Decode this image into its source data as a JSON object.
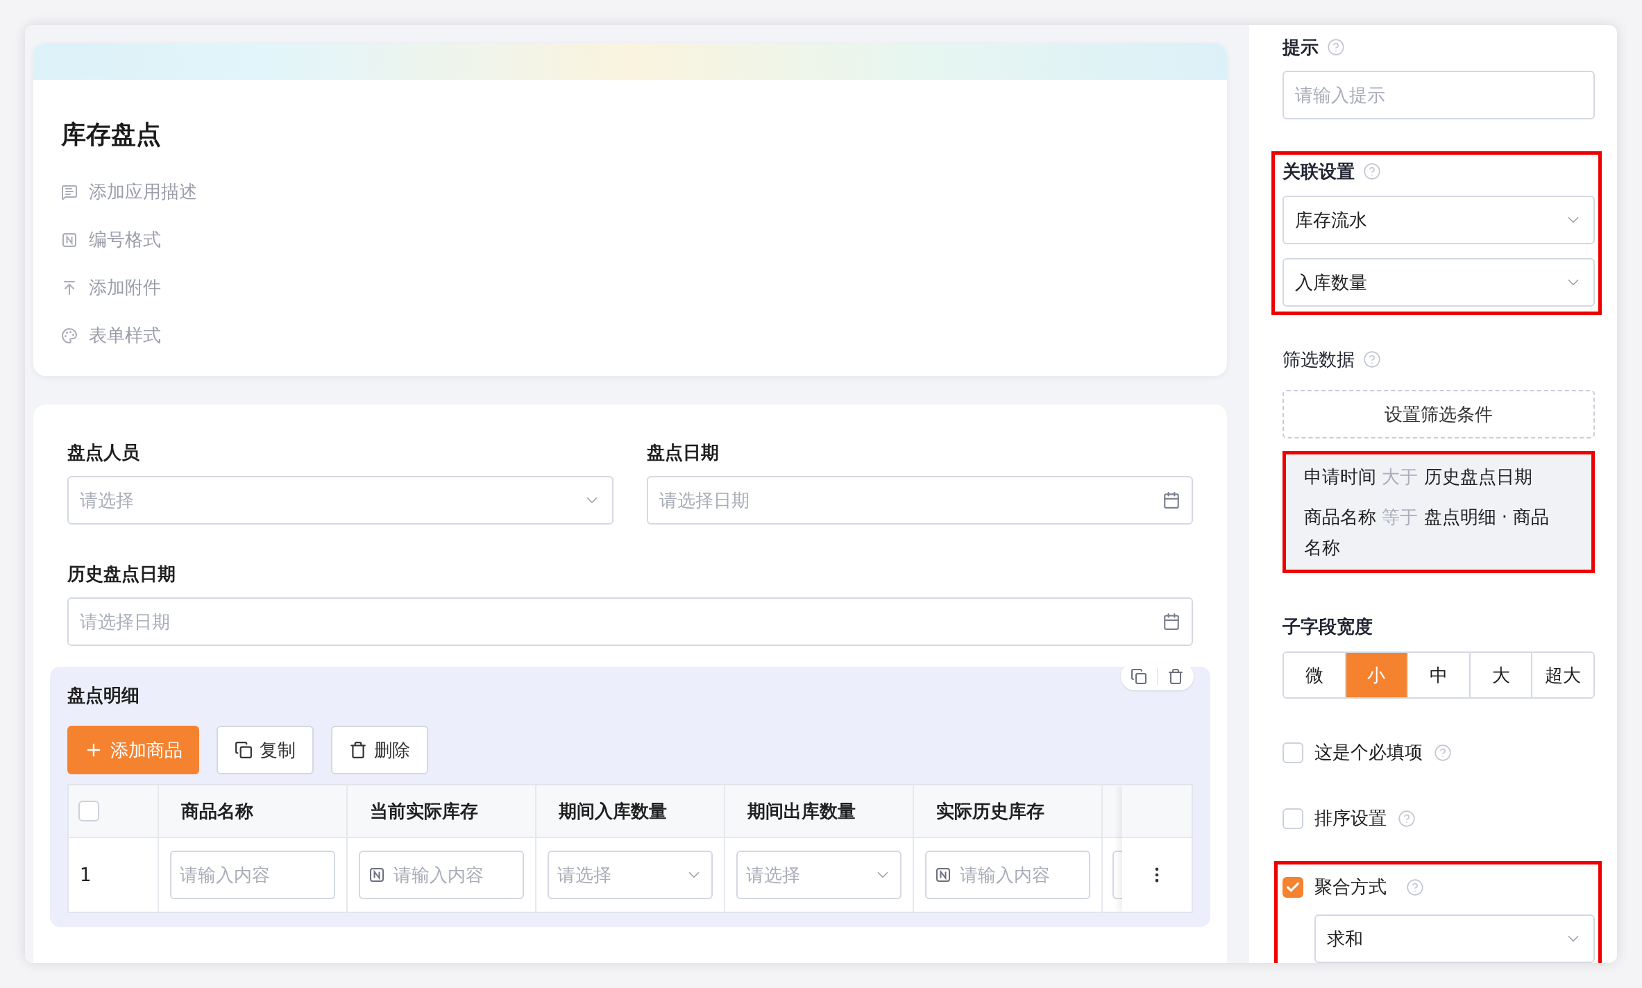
{
  "app": {
    "title": "库存盘点",
    "actions": [
      {
        "kind": "description",
        "label": "添加应用描述"
      },
      {
        "kind": "numbering",
        "label": "编号格式"
      },
      {
        "kind": "attachment",
        "label": "添加附件"
      },
      {
        "kind": "style",
        "label": "表单样式"
      }
    ]
  },
  "form": {
    "fields": [
      {
        "label": "盘点人员",
        "kind": "select",
        "placeholder": "请选择"
      },
      {
        "label": "盘点日期",
        "kind": "date",
        "placeholder": "请选择日期"
      },
      {
        "label": "历史盘点日期",
        "kind": "date",
        "placeholder": "请选择日期"
      }
    ]
  },
  "subtable": {
    "title": "盘点明细",
    "buttons": [
      {
        "kind": "add",
        "label": "添加商品"
      },
      {
        "kind": "copy",
        "label": "复制"
      },
      {
        "kind": "delete",
        "label": "删除"
      }
    ],
    "header_checked": false,
    "columns": [
      "商品名称",
      "当前实际库存",
      "期间入库数量",
      "期间出库数量",
      "实际历史库存"
    ],
    "rows": [
      {
        "index": "1",
        "cells": [
          {
            "kind": "text",
            "placeholder": "请输入内容"
          },
          {
            "kind": "number",
            "placeholder": "请输入内容"
          },
          {
            "kind": "select",
            "placeholder": "请选择"
          },
          {
            "kind": "select",
            "placeholder": "请选择"
          },
          {
            "kind": "number",
            "placeholder": "请输入内容"
          }
        ]
      }
    ]
  },
  "settings": {
    "hint": {
      "label": "提示",
      "placeholder": "请输入提示"
    },
    "relation": {
      "label": "关联设置",
      "values": [
        "库存流水",
        "入库数量"
      ]
    },
    "filter": {
      "label": "筛选数据",
      "button": "设置筛选条件",
      "conditions": [
        {
          "field": "申请时间",
          "operator": "大于",
          "value": "历史盘点日期"
        },
        {
          "field": "商品名称",
          "operator": "等于",
          "value": "盘点明细 · 商品名称"
        }
      ]
    },
    "width": {
      "label": "子字段宽度",
      "options": [
        {
          "label": "微",
          "selected": false
        },
        {
          "label": "小",
          "selected": true
        },
        {
          "label": "中",
          "selected": false
        },
        {
          "label": "大",
          "selected": false
        },
        {
          "label": "超大",
          "selected": false
        }
      ]
    },
    "required": {
      "label": "这是个必填项",
      "checked": false
    },
    "sort": {
      "label": "排序设置",
      "checked": false
    },
    "aggregate": {
      "label": "聚合方式",
      "checked": true,
      "value": "求和"
    }
  }
}
